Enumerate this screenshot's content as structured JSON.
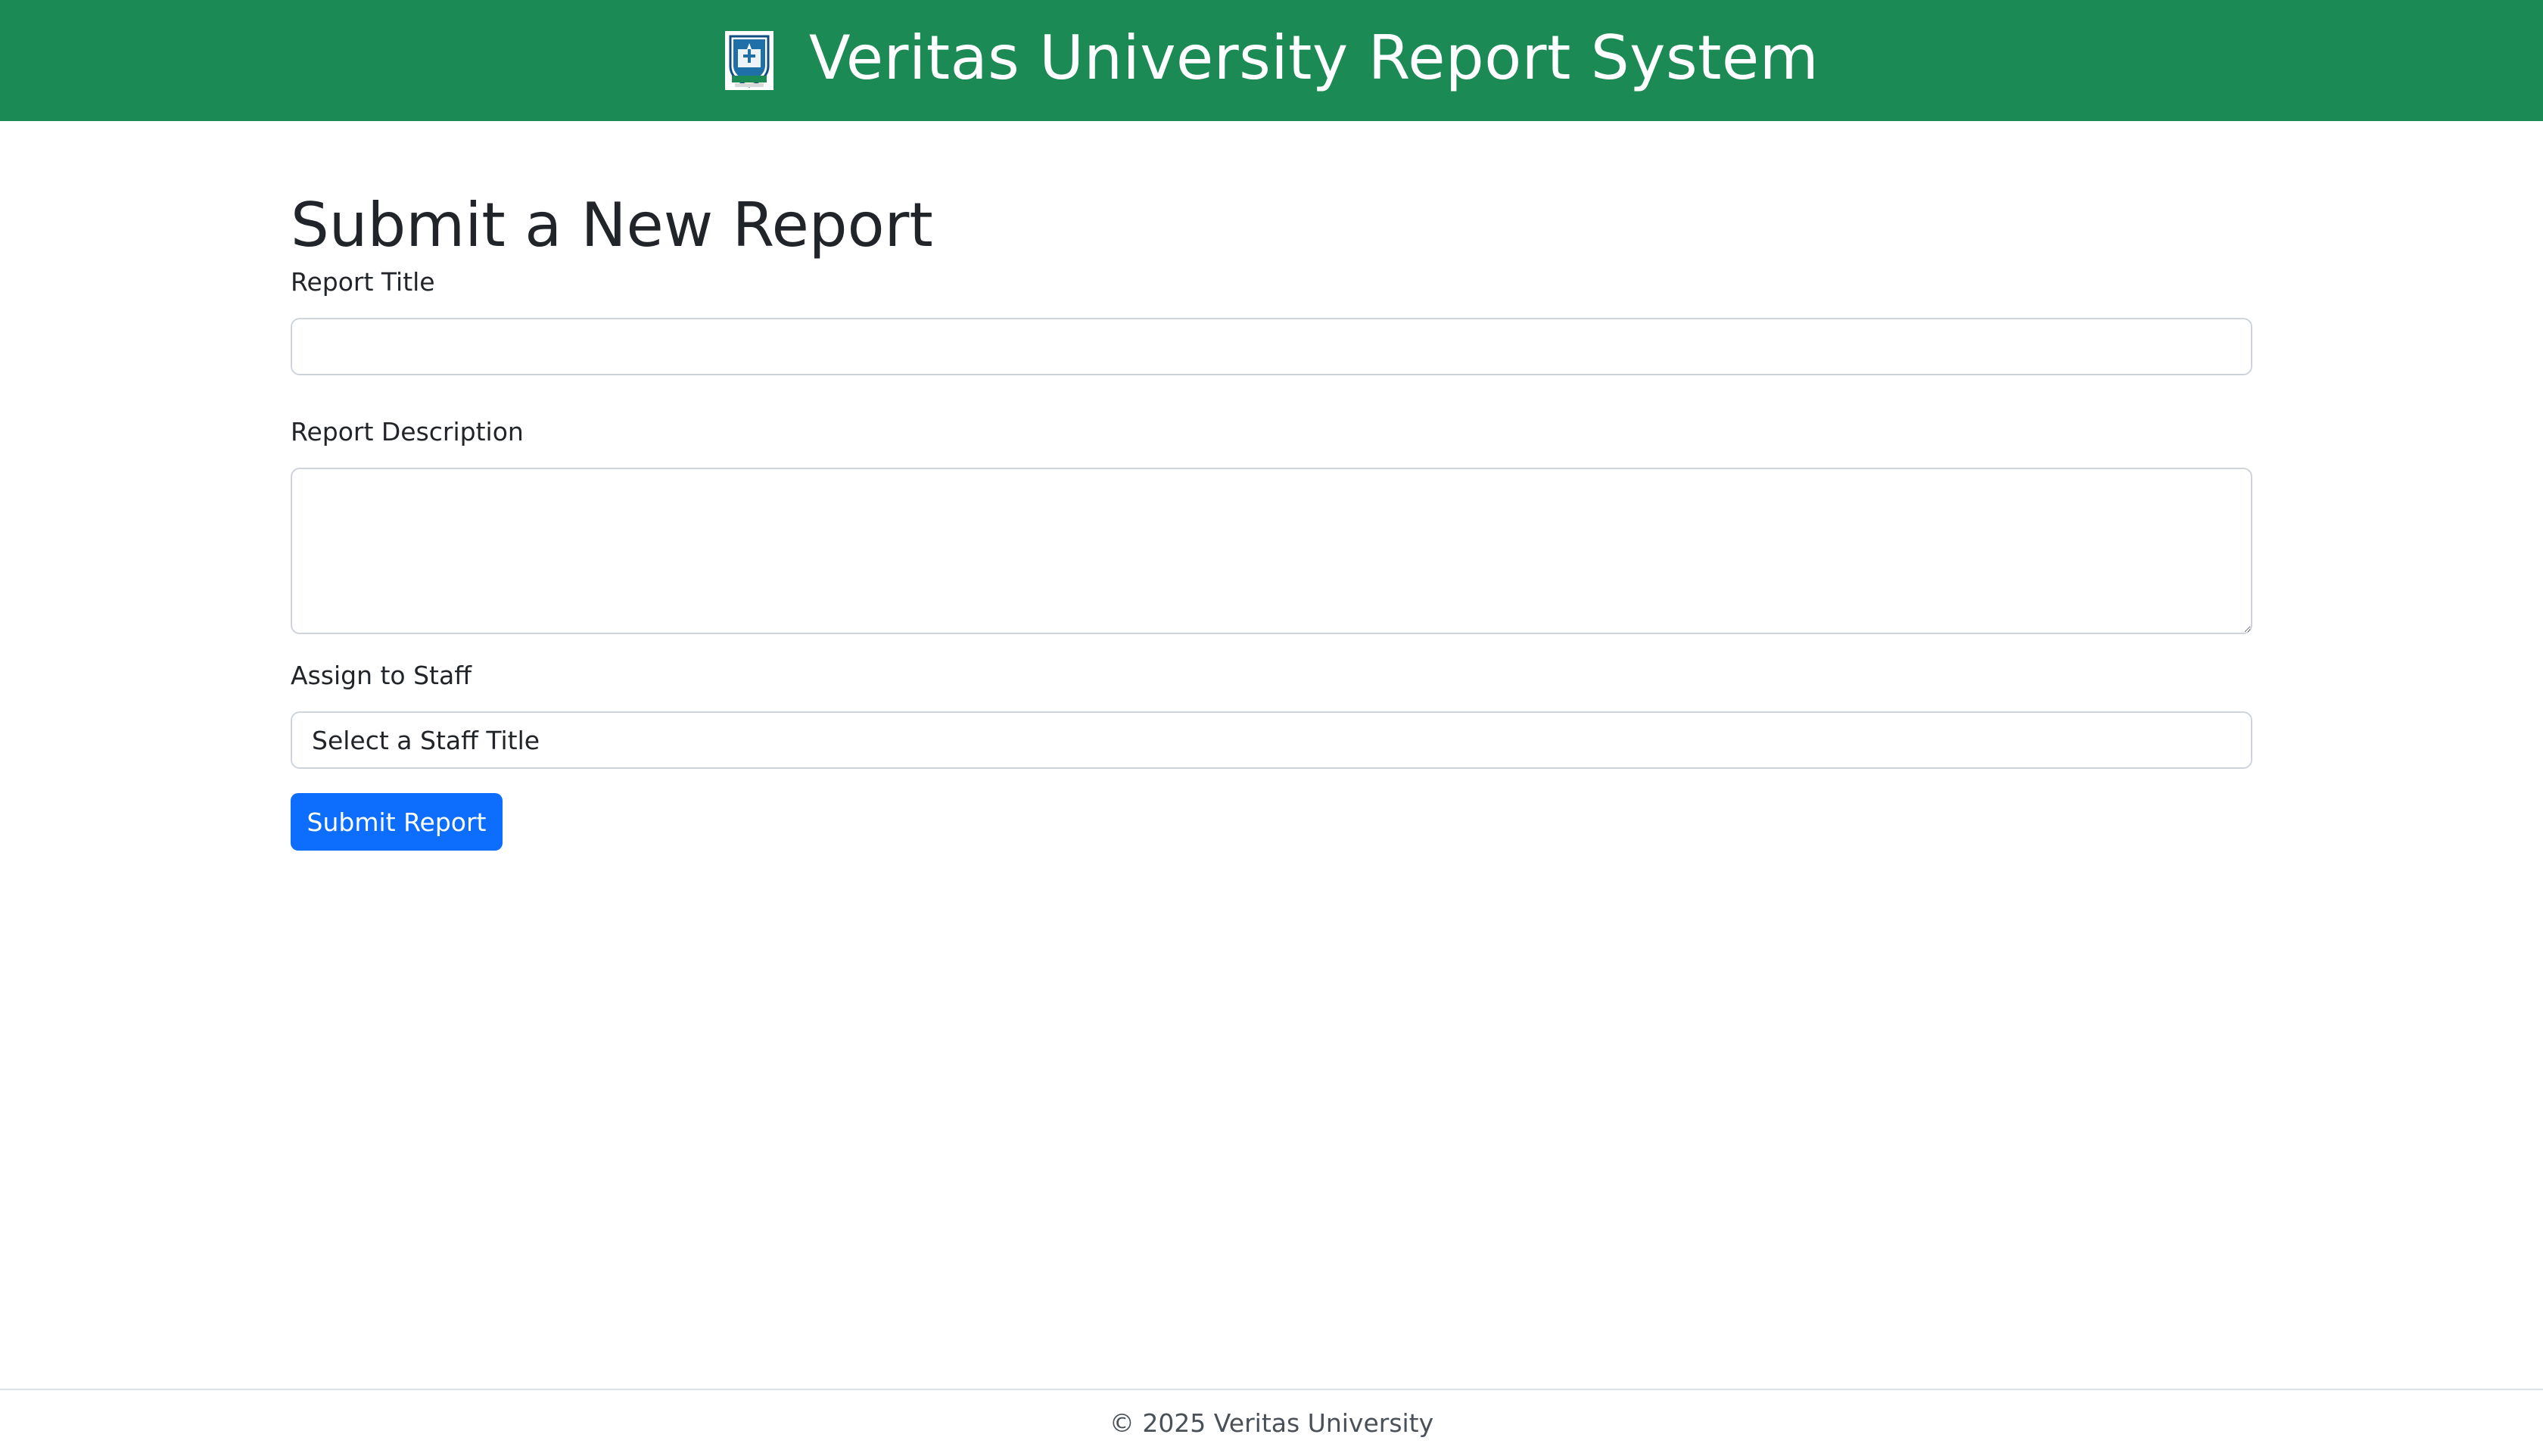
{
  "header": {
    "title": "Veritas University Report System",
    "logo_icon": "university-crest-icon",
    "background_color": "#1b8a55"
  },
  "form": {
    "page_title": "Submit a New Report",
    "report_title_label": "Report Title",
    "report_title_value": "",
    "report_description_label": "Report Description",
    "report_description_value": "",
    "assign_label": "Assign to Staff",
    "assign_selected": "Select a Staff Title",
    "submit_label": "Submit Report",
    "submit_color": "#0d6efd"
  },
  "footer": {
    "text": "© 2025 Veritas University"
  }
}
